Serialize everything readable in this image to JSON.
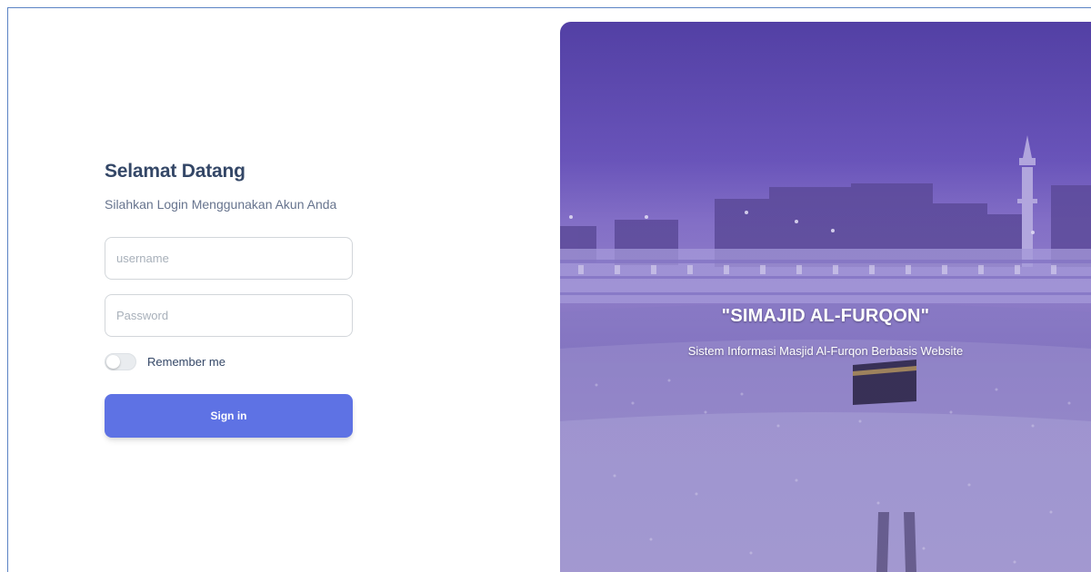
{
  "login": {
    "title": "Selamat Datang",
    "subtitle": "Silahkan Login Menggunakan Akun Anda",
    "username_placeholder": "username",
    "password_placeholder": "Password",
    "remember_label": "Remember me",
    "remember_checked": false,
    "signin_label": "Sign in"
  },
  "hero": {
    "title": "\"SIMAJID AL-FURQON\"",
    "subtitle": "Sistem Informasi Masjid Al-Furqon Berbasis Website",
    "image_subject": "masjid-al-haram-kaaba-photo"
  },
  "colors": {
    "accent": "#5e72e4",
    "heading": "#344767",
    "text_muted": "#67748e",
    "hero_tint": "#6b57b8"
  }
}
